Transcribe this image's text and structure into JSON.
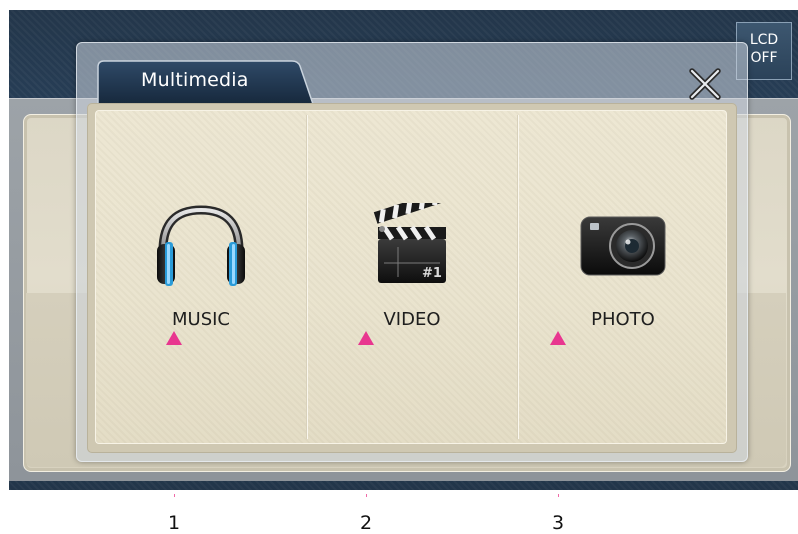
{
  "top_right_button": {
    "label": "LCD\nOFF"
  },
  "popup": {
    "title": "Multimedia",
    "close_icon": "close-x-icon",
    "items": [
      {
        "label": "MUSIC",
        "icon": "headphones-icon"
      },
      {
        "label": "VIDEO",
        "icon": "clapperboard-icon"
      },
      {
        "label": "PHOTO",
        "icon": "camera-icon"
      }
    ]
  },
  "callouts": [
    "1",
    "2",
    "3"
  ],
  "colors": {
    "accent_marker": "#e8368f",
    "tab_blue": "#1f3550",
    "panel_beige": "#ebe5d0"
  }
}
